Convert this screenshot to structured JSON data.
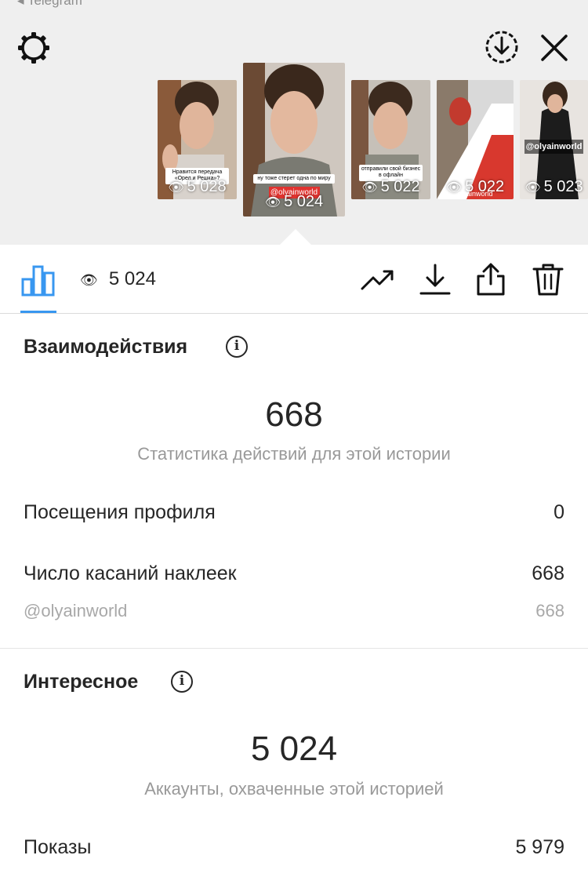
{
  "status_bar": {
    "back_label": "◂ Telegram"
  },
  "top_bar": {
    "settings_icon": "gear-icon",
    "download_icon": "download-circle-icon",
    "close_icon": "close-icon"
  },
  "thumbnails": [
    {
      "views": "5 028",
      "caption": "Нравится передача «Орел и Решка»?"
    },
    {
      "views": "5 024",
      "caption": "ну тоже стерет одна по миру",
      "tag": "@olyainworld",
      "selected": true
    },
    {
      "views": "5 022",
      "caption": "отправили свой бизнес в офлайн"
    },
    {
      "views": "5 022",
      "brand": "olyainworld"
    },
    {
      "views": "5 023",
      "brand": "@olyainworld"
    }
  ],
  "toolbar": {
    "insights_icon": "bar-chart-icon",
    "views_icon": "eye-icon",
    "views_value": "5 024",
    "promote_icon": "trending-up-icon",
    "save_icon": "download-icon",
    "share_icon": "share-icon",
    "delete_icon": "trash-icon"
  },
  "interactions": {
    "title": "Взаимодействия",
    "total": "668",
    "caption": "Статистика действий для этой истории",
    "rows": [
      {
        "label": "Посещения профиля",
        "value": "0"
      },
      {
        "label": "Число касаний наклеек",
        "value": "668"
      },
      {
        "label": "@olyainworld",
        "value": "668"
      }
    ]
  },
  "discovery": {
    "title": "Интересное",
    "total": "5 024",
    "caption": "Аккаунты, охваченные этой историей",
    "rows": [
      {
        "label": "Показы",
        "value": "5 979"
      }
    ]
  },
  "colors": {
    "accent": "#3897f0",
    "background_top": "#efefef",
    "muted_text": "#999999"
  }
}
